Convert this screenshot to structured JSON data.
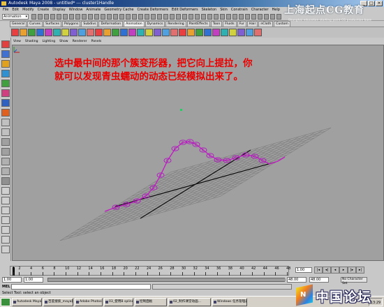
{
  "window": {
    "title": "Autodesk Maya 2008 - untitled* --- cluster1Handle"
  },
  "watermark_top": {
    "cn": "上海起点CG教育",
    "en": "Shanghai education starting point CG production base"
  },
  "menus": [
    "File",
    "Edit",
    "Modify",
    "Create",
    "Display",
    "Window",
    "Animate",
    "Geometry Cache",
    "Create Deformers",
    "Edit Deformers",
    "Skeleton",
    "Skin",
    "Constrain",
    "Character",
    "Help"
  ],
  "status_line": {
    "mode": "Animation"
  },
  "shelf_tabs": [
    "General",
    "Curves",
    "Surfaces",
    "Polygons",
    "Subdivs",
    "Deformation",
    "Animation",
    "Dynamics",
    "Rendering",
    "PaintEffects",
    "Toon",
    "Fluids",
    "Fur",
    "Hair",
    "nCloth",
    "Custom"
  ],
  "shelf_active_tab": "Animation",
  "panel_menus": [
    "View",
    "Shading",
    "Lighting",
    "Show",
    "Renderer",
    "Panels"
  ],
  "caption": {
    "line1": "选中最中间的那个簇变形器，把它向上提拉，你",
    "line2": "就可以发现青虫蠕动的动态已经模拟出来了。"
  },
  "timeline": {
    "ticks": [
      "1",
      "2",
      "4",
      "6",
      "8",
      "10",
      "12",
      "14",
      "16",
      "18",
      "20",
      "22",
      "24",
      "26",
      "28",
      "30",
      "32",
      "34",
      "36",
      "38",
      "40",
      "42",
      "44",
      "46",
      "48"
    ],
    "current_frame": "1.00",
    "playhead_frame": 1,
    "range_max": 48
  },
  "range": {
    "start": "1.00",
    "inner_start": "1.00",
    "end": "48.00",
    "inner_end": "48.00",
    "character_set": "No Character Set"
  },
  "command_line": {
    "label": "MEL"
  },
  "help_line": {
    "text": "Select Tool: select an object"
  },
  "taskbar": {
    "tasks": [
      "Autodesk Maya 2008...",
      "百度搜索_maya教...",
      "Adobe Photoshop",
      "03_使用B spline N...",
      "控制面板",
      "02_制作课堂动画...",
      "Windows 任务管理器"
    ],
    "clock": "13:29"
  },
  "watermark_bottom": {
    "logo_letter": "N",
    "text": "中国论坛"
  },
  "colors": {
    "accent_caption": "#e80000",
    "curve": "#c020c0",
    "viewport_bg": "#a0a0a0"
  },
  "icons": {
    "start": "windows-start-icon",
    "gizmo": "axis-gizmo-icon"
  }
}
